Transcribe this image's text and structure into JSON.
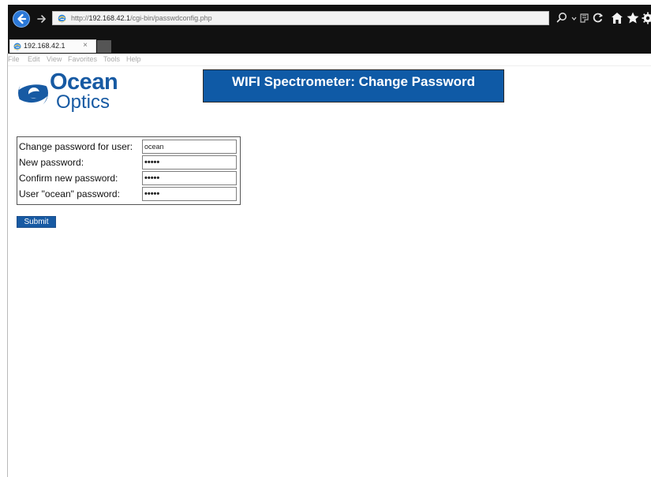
{
  "browser": {
    "address": {
      "prefix": "http://",
      "host": "192.168.42.1",
      "path": "/cgi-bin/passwdconfig.php"
    },
    "tab": {
      "label": "192.168.42.1",
      "close": "×"
    },
    "menu": [
      "File",
      "Edit",
      "View",
      "Favorites",
      "Tools",
      "Help"
    ],
    "icons": [
      "search-icon",
      "dropdown-icon",
      "compatibility-icon",
      "refresh-icon",
      "home-icon",
      "favorites-icon",
      "settings-icon"
    ],
    "colors": {
      "chrome": "#111111",
      "back_button": "#2a78d8"
    }
  },
  "page": {
    "logo": {
      "line1": "Ocean",
      "line2": "Optics",
      "color": "#175aa3"
    },
    "banner": {
      "title": "WIFI Spectrometer: Change Password",
      "color": "#0f5aa6"
    },
    "form": {
      "fields": [
        {
          "label": "Change password for user:",
          "value": "ocean",
          "type": "text"
        },
        {
          "label": "New password:",
          "value": "•••••",
          "type": "password"
        },
        {
          "label": "Confirm new password:",
          "value": "•••••",
          "type": "password"
        },
        {
          "label": "User \"ocean\" password:",
          "value": "•••••",
          "type": "password"
        }
      ],
      "submit_label": "Submit"
    }
  }
}
